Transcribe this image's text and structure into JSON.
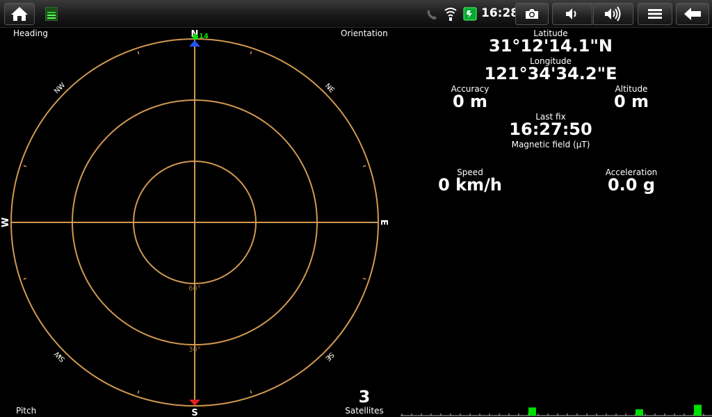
{
  "status_bar": {
    "time": "16:28"
  },
  "sky_view": {
    "heading_label": "Heading",
    "orientation_label": "Orientation",
    "pitch_label": "Pitch",
    "cardinals": {
      "n": "N",
      "e": "E",
      "s": "S",
      "w": "W"
    },
    "intercardinals": {
      "nw": "NW",
      "ne": "NE",
      "sw": "SW",
      "se": "SE"
    },
    "elevation_60": "60°",
    "elevation_30": "30°",
    "satellite_prn": "14",
    "satellites_count": "3",
    "satellites_label": "Satellites"
  },
  "gps": {
    "latitude_label": "Latitude",
    "latitude_value": "31°12'14.1\"N",
    "longitude_label": "Longitude",
    "longitude_value": "121°34'34.2\"E",
    "accuracy_label": "Accuracy",
    "accuracy_value": "0 m",
    "altitude_label": "Altitude",
    "altitude_value": "0 m",
    "last_fix_label": "Last fix",
    "last_fix_value": "16:27:50",
    "magnetic_label": "Magnetic field (µT)",
    "speed_label": "Speed",
    "speed_value": "0 km/h",
    "acceleration_label": "Acceleration",
    "acceleration_value": "0.0 g"
  },
  "colors": {
    "ring": "#d29a50",
    "signal_bar": "#00e000",
    "north_marker": "#2255ff",
    "south_marker": "#e02020"
  },
  "signal_bars": [
    {
      "level": 0.45
    },
    {
      "level": 0.35
    },
    {
      "level": 0.6
    }
  ]
}
